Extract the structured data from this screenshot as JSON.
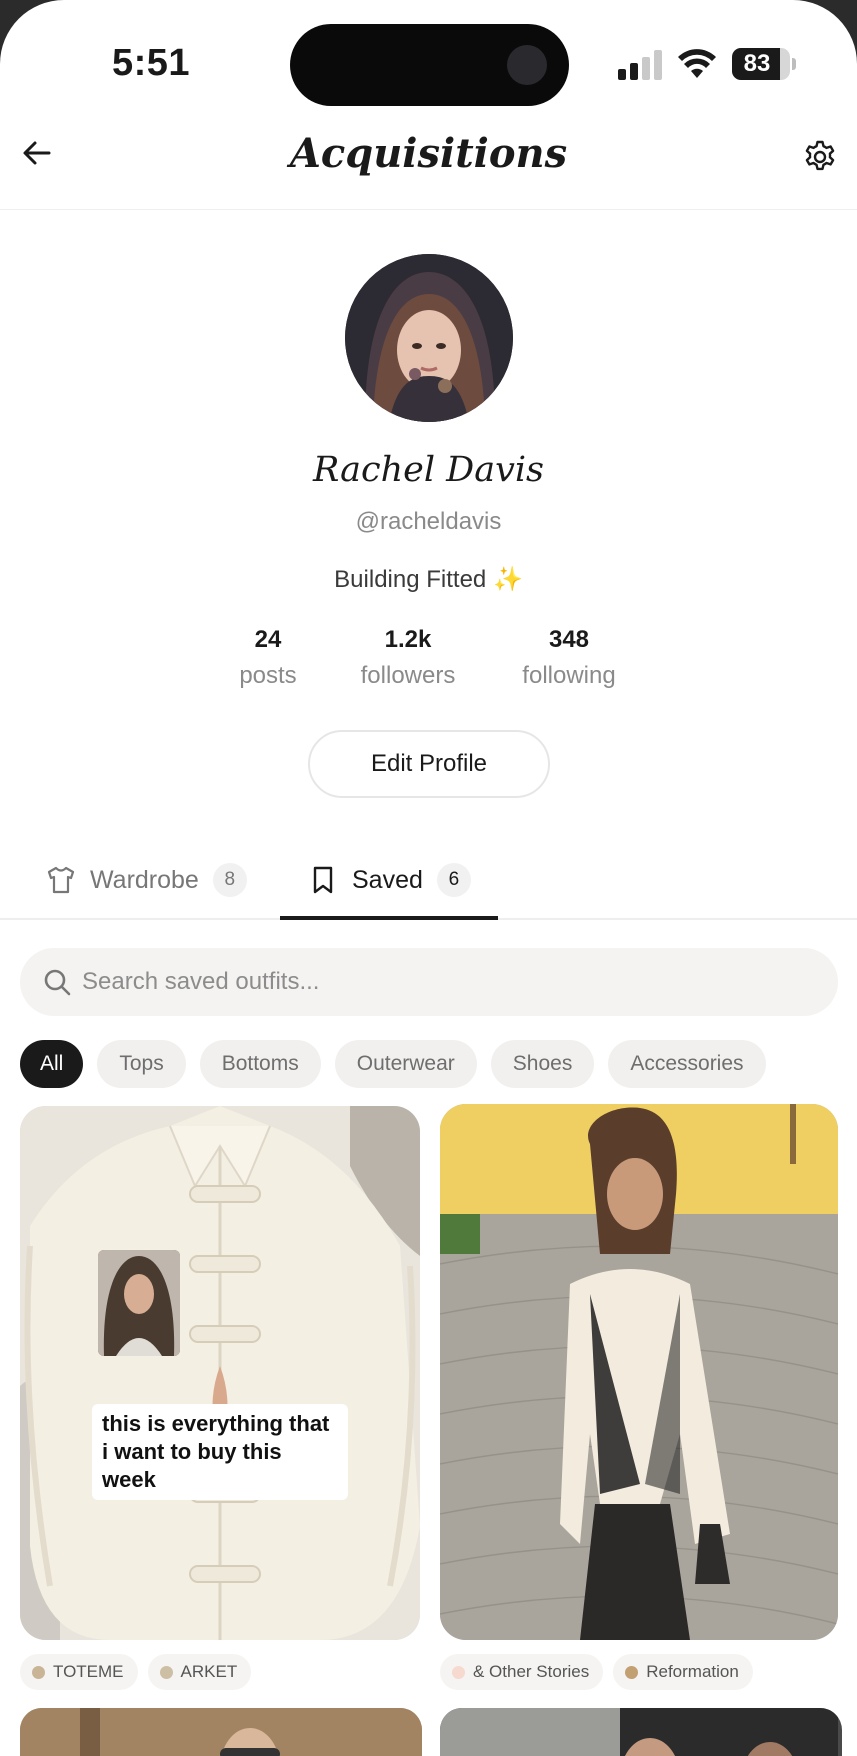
{
  "status_bar": {
    "time": "5:51",
    "battery": "83",
    "battery_level": 0.83
  },
  "header": {
    "title": "Acquisitions"
  },
  "profile": {
    "name": "Rachel Davis",
    "handle": "@racheldavis",
    "bio": "Building Fitted",
    "bio_emoji": "✨",
    "stats": [
      {
        "value": "24",
        "label": "posts"
      },
      {
        "value": "1.2k",
        "label": "followers"
      },
      {
        "value": "348",
        "label": "following"
      }
    ],
    "edit_label": "Edit Profile"
  },
  "tabs": [
    {
      "label": "Wardrobe",
      "count": "8",
      "icon": "shirt-icon",
      "active": false
    },
    {
      "label": "Saved",
      "count": "6",
      "icon": "bookmark-icon",
      "active": true
    }
  ],
  "search": {
    "placeholder": "Search saved outfits..."
  },
  "filters": [
    "All",
    "Tops",
    "Bottoms",
    "Outerwear",
    "Shoes",
    "Accessories"
  ],
  "cards": [
    {
      "overlay_text": "this is everything that i want to buy this week",
      "tags": [
        {
          "label": "TOTEME",
          "color": "#c9b596"
        },
        {
          "label": "ARKET",
          "color": "#cdbfa4"
        }
      ]
    },
    {
      "tags": [
        {
          "label": "& Other Stories",
          "color": "#f6d9cf"
        },
        {
          "label": "Reformation",
          "color": "#c2a072"
        }
      ]
    }
  ],
  "colors": {
    "accent": "#1a1a1a",
    "chip_bg": "#f1f0ee",
    "search_bg": "#f4f3f1"
  }
}
